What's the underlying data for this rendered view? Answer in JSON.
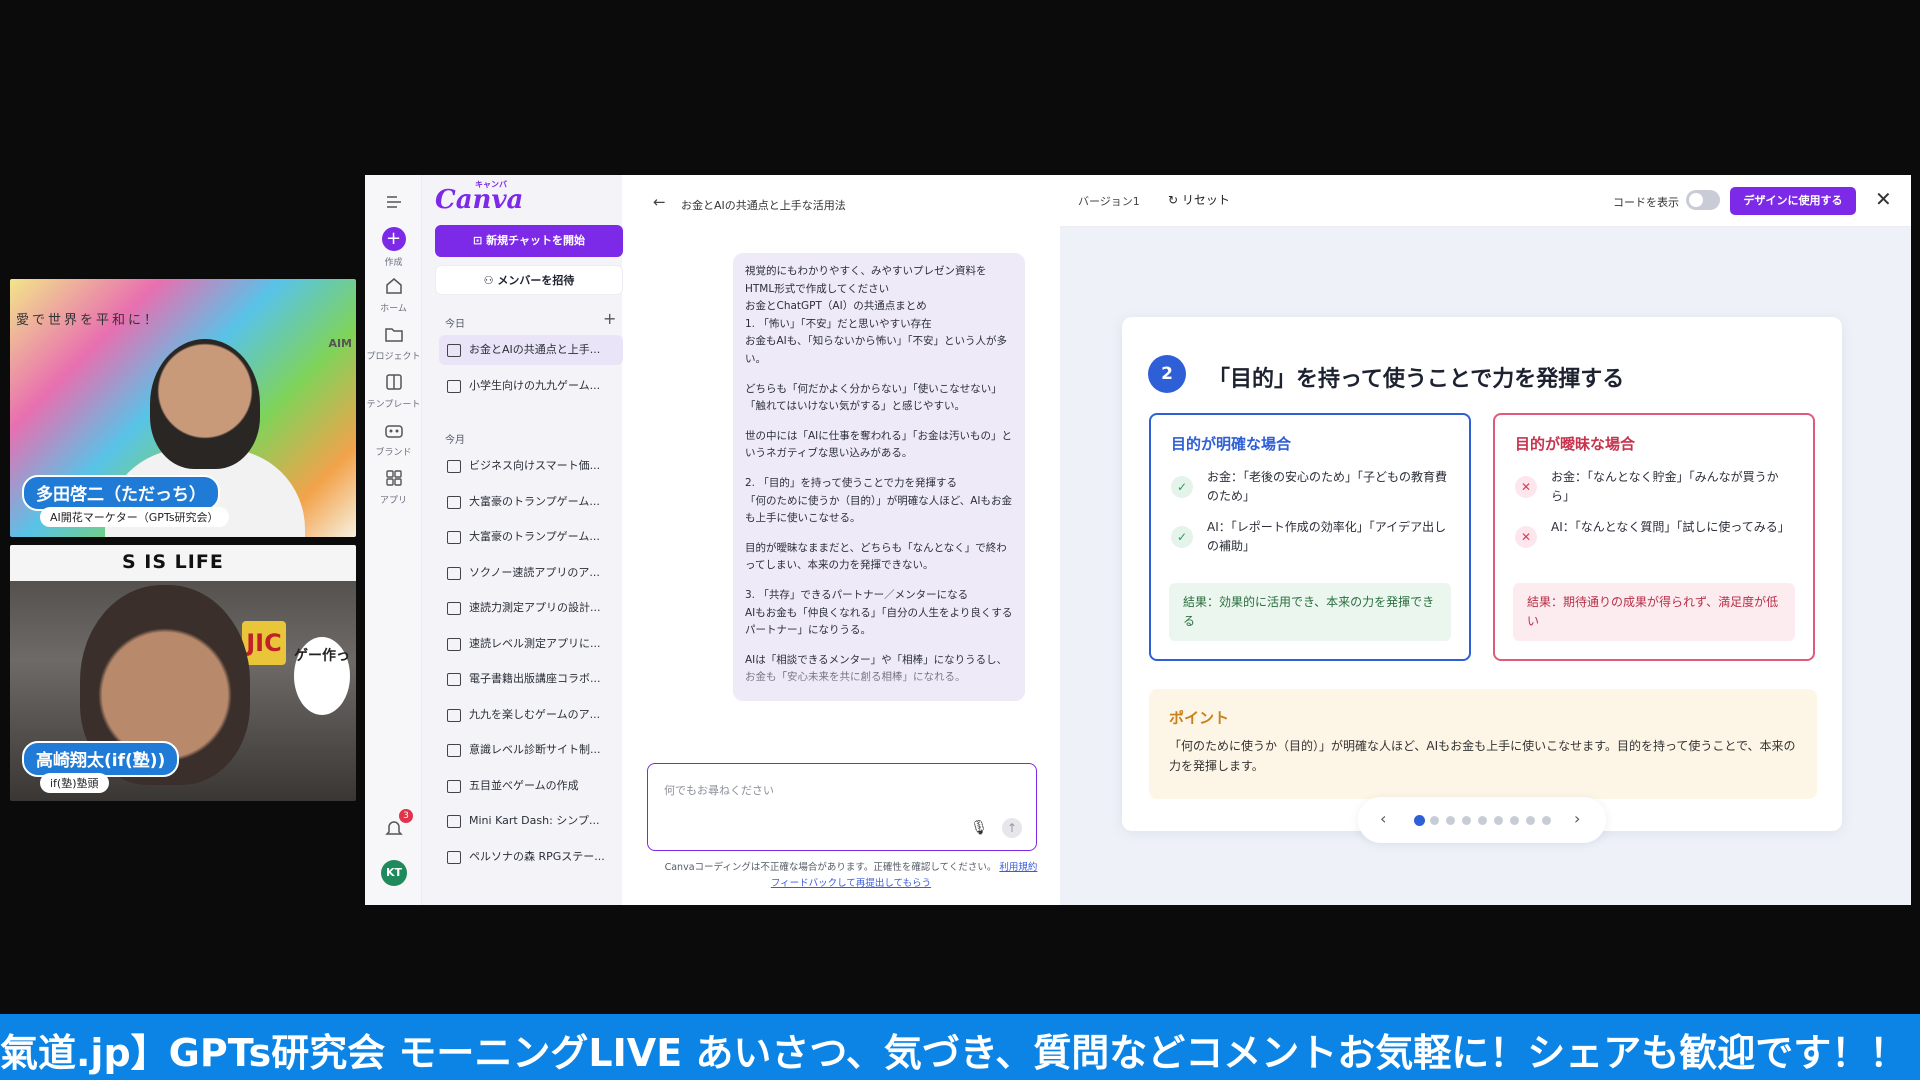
{
  "webcams": {
    "cam1": {
      "banner": "愛で世界を平和に！",
      "aim_text": "AIM",
      "name": "多田啓二（ただっち）",
      "role": "AI開花マーケター（GPTs研究会）"
    },
    "cam2": {
      "motto": "S IS LIFE",
      "sticker": "JIC",
      "bubble": "ゲー作っ",
      "name": "高崎翔太(if(塾))",
      "role": "if(塾)塾頭"
    }
  },
  "rail": {
    "items": [
      {
        "label": "作成",
        "icon": "plus-icon"
      },
      {
        "label": "ホーム",
        "icon": "home-icon"
      },
      {
        "label": "プロジェクト",
        "icon": "folder-icon"
      },
      {
        "label": "テンプレート",
        "icon": "template-icon"
      },
      {
        "label": "ブランド",
        "icon": "brand-icon"
      },
      {
        "label": "アプリ",
        "icon": "apps-icon"
      }
    ],
    "notif_count": "3",
    "avatar": "KT"
  },
  "sidebar": {
    "logo": "Canva",
    "logo_sub": "キャンバ",
    "new_chat": "新規チャットを開始",
    "invite": "メンバーを招待",
    "today_label": "今日",
    "month_label": "今月",
    "today_items": [
      "お金とAIの共通点と上手...",
      "小学生向けの九九ゲーム..."
    ],
    "month_items": [
      "ビジネス向けスマート価...",
      "大富豪のトランプゲーム...",
      "大富豪のトランプゲーム...",
      "ソクノー速読アプリのア...",
      "速読力測定アプリの設計...",
      "速読レベル測定アプリに...",
      "電子書籍出版講座コラボ...",
      "九九を楽しむゲームのア...",
      "意識レベル診断サイト制...",
      "五目並べゲームの作成",
      "Mini Kart Dash: シンプ...",
      "ペルソナの森 RPGステー..."
    ]
  },
  "chat": {
    "title": "お金とAIの共通点と上手な活用法",
    "message_paragraphs": [
      "視覚的にもわかりやすく、みやすいプレゼン資料をHTML形式で作成してください\nお金とChatGPT（AI）の共通点まとめ\n1. 「怖い」「不安」だと思いやすい存在\nお金もAIも、「知らないから怖い」「不安」という人が多い。",
      "どちらも「何だかよく分からない」「使いこなせない」「触れてはいけない気がする」と感じやすい。",
      "世の中には「AIに仕事を奪われる」「お金は汚いもの」というネガティブな思い込みがある。",
      "2. 「目的」を持って使うことで力を発揮する\n「何のために使うか（目的）」が明確な人ほど、AIもお金も上手に使いこなせる。",
      "目的が曖昧なままだと、どちらも「なんとなく」で終わってしまい、本来の力を発揮できない。",
      "3. 「共存」できるパートナー／メンターになる\nAIもお金も「仲良くなれる」「自分の人生をより良くするパートナー」になりうる。",
      "AIは「相談できるメンター」や「相棒」になりうるし、お金も「安心未来を共に創る相棒」になれる。"
    ],
    "input_placeholder": "何でもお尋ねください",
    "disclaimer": "Canvaコーディングは不正確な場合があります。正確性を確認してください。",
    "terms_link": "利用規約",
    "feedback_link": "フィードバックして再提出してもらう"
  },
  "preview": {
    "version": "バージョン1",
    "reset": "リセット",
    "code_label": "コードを表示",
    "use_button": "デザインに使用する",
    "slide": {
      "number": "2",
      "title": "「目的」を持って使うことで力を発揮する",
      "good": {
        "heading": "目的が明確な場合",
        "items": [
          "お金：「老後の安心のため」「子どもの教育費のため」",
          "AI：「レポート作成の効率化」「アイデア出しの補助」"
        ],
        "result": "結果：効果的に活用でき、本来の力を発揮できる"
      },
      "bad": {
        "heading": "目的が曖昧な場合",
        "items": [
          "お金：「なんとなく貯金」「みんなが買うから」",
          "AI：「なんとなく質問」「試しに使ってみる」"
        ],
        "result": "結果：期待通りの成果が得られず、満足度が低い"
      },
      "point": {
        "heading": "ポイント",
        "text": "「何のために使うか（目的）」が明確な人ほど、AIもお金も上手に使いこなせます。目的を持って使うことで、本来の力を発揮します。"
      }
    },
    "pager": {
      "total": 9,
      "active": 1
    }
  },
  "ticker": "氣道.jp】GPTs研究会 モーニングLIVE あいさつ、気づき、質問などコメントお気軽に！シェアも歓迎です！！",
  "colors": {
    "canva_purple": "#7d2ae8",
    "primary_blue": "#2f5fd6",
    "danger_pink": "#e05a7a",
    "ticker_blue": "#0b84e6"
  }
}
